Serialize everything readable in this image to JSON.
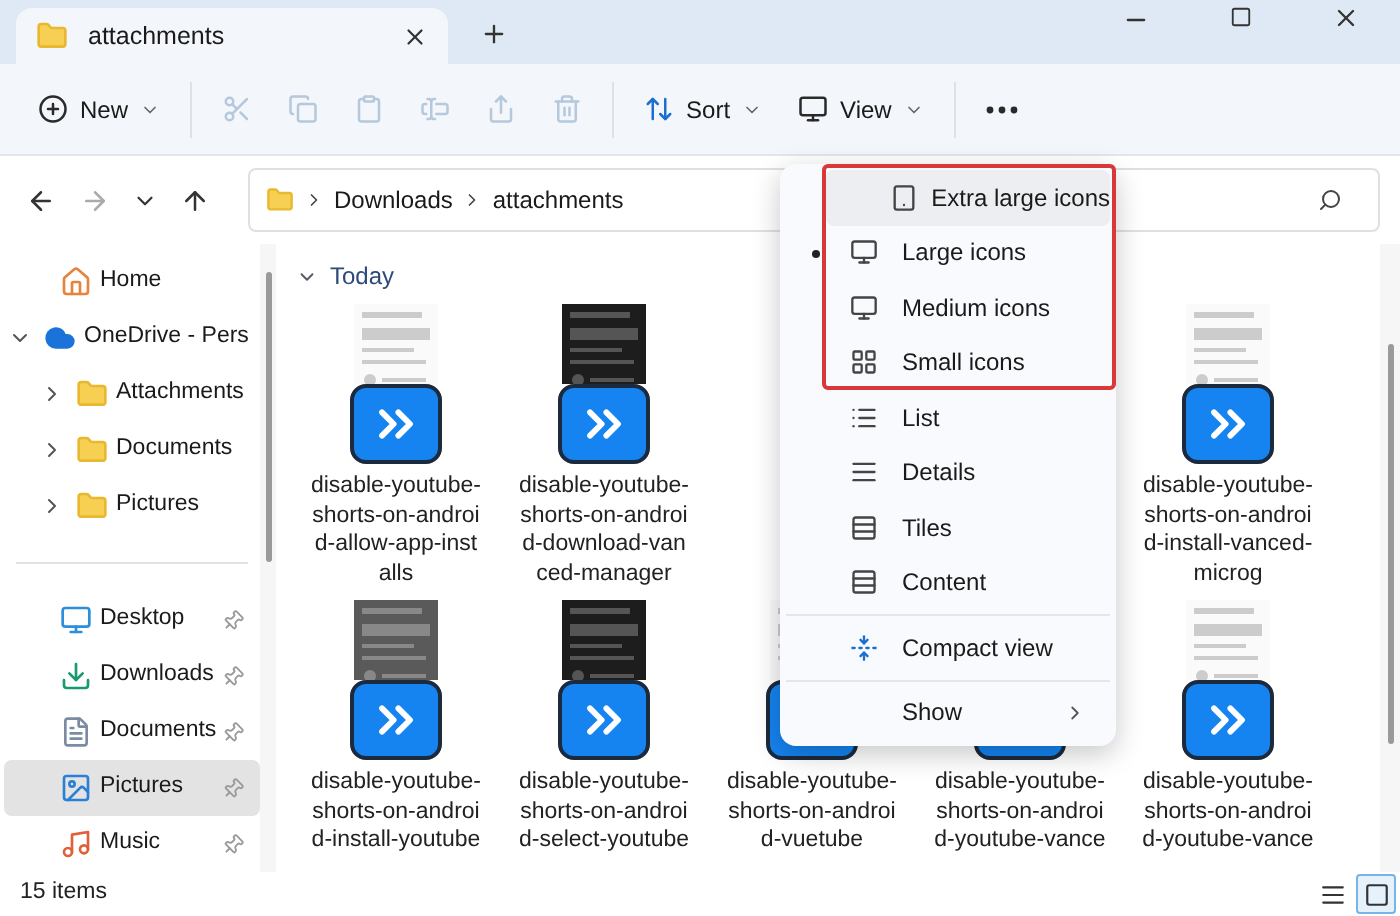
{
  "window": {
    "tab": {
      "title": "attachments",
      "selected": true
    }
  },
  "toolbar": {
    "items": [
      {
        "kind": "new",
        "label": "New",
        "disabled": false
      },
      {
        "kind": "cut",
        "disabled": true
      },
      {
        "kind": "copy",
        "disabled": true
      },
      {
        "kind": "paste",
        "disabled": true
      },
      {
        "kind": "rename",
        "disabled": true
      },
      {
        "kind": "share",
        "disabled": true
      },
      {
        "kind": "delete",
        "disabled": true
      },
      {
        "kind": "sort",
        "label": "Sort",
        "disabled": false
      },
      {
        "kind": "view",
        "label": "View",
        "disabled": false
      },
      {
        "kind": "more",
        "disabled": false
      }
    ]
  },
  "address_bar": {
    "path": [
      "Downloads",
      "attachments"
    ]
  },
  "sidebar": {
    "items": [
      {
        "kind": "home",
        "label": "Home",
        "selected": false
      },
      {
        "kind": "cloud",
        "label": "OneDrive - Pers",
        "selected": false,
        "expanded": true,
        "children": [
          {
            "kind": "folder",
            "label": "Attachments",
            "expanded": false,
            "selected": false
          },
          {
            "kind": "folder",
            "label": "Documents",
            "expanded": false,
            "selected": false
          },
          {
            "kind": "folder",
            "label": "Pictures",
            "expanded": false,
            "selected": false
          }
        ]
      }
    ],
    "quick_access": [
      {
        "kind": "desktop",
        "label": "Desktop",
        "pinned": true,
        "selected": false
      },
      {
        "kind": "downloads",
        "label": "Downloads",
        "pinned": true,
        "selected": false
      },
      {
        "kind": "documents",
        "label": "Documents",
        "pinned": true,
        "selected": false
      },
      {
        "kind": "pictures",
        "label": "Pictures",
        "pinned": true,
        "selected": true
      },
      {
        "kind": "music",
        "label": "Music",
        "pinned": true,
        "selected": false
      }
    ]
  },
  "group": {
    "title": "Today",
    "expanded": true
  },
  "files": [
    {
      "name": "disable-youtube-shorts-on-android-allow-app-installs"
    },
    {
      "name": "disable-youtube-shorts-on-android-download-vanced-manager"
    },
    {
      "name": "disable-youtube-shorts-on-android-install-vanced-microg"
    },
    {
      "name": "disable-youtube-shorts-on-android-install-youtube"
    },
    {
      "name": "disable-youtube-shorts-on-android-select-youtube"
    },
    {
      "name": "disable-youtube-shorts-on-android-vuetube"
    },
    {
      "name": "disable-youtube-shorts-on-android-youtube-vance"
    },
    {
      "name": "disable-youtube-shorts-on-android-youtube-vance"
    }
  ],
  "view_menu": {
    "sections": [
      {
        "outlined": true,
        "items": [
          {
            "kind": "xl",
            "label": "Extra large icons",
            "selected": false,
            "hovered": true
          },
          {
            "kind": "large",
            "label": "Large icons",
            "selected": true,
            "hovered": false
          },
          {
            "kind": "medium",
            "label": "Medium icons",
            "selected": false,
            "hovered": false
          },
          {
            "kind": "small",
            "label": "Small icons",
            "selected": false,
            "hovered": false
          }
        ]
      },
      {
        "outlined": false,
        "items": [
          {
            "kind": "list",
            "label": "List",
            "selected": false,
            "hovered": false
          },
          {
            "kind": "details",
            "label": "Details",
            "selected": false,
            "hovered": false
          },
          {
            "kind": "tiles",
            "label": "Tiles",
            "selected": false,
            "hovered": false
          },
          {
            "kind": "content",
            "label": "Content",
            "selected": false,
            "hovered": false
          }
        ]
      },
      {
        "outlined": false,
        "items": [
          {
            "kind": "compact",
            "label": "Compact view",
            "selected": false,
            "hovered": false
          }
        ]
      },
      {
        "outlined": false,
        "items": [
          {
            "kind": "submenu",
            "label": "Show",
            "selected": false,
            "hovered": false
          }
        ]
      }
    ]
  },
  "status_bar": {
    "count": "15 items",
    "view_buttons": [
      {
        "kind": "details",
        "selected": false
      },
      {
        "kind": "large",
        "selected": true
      }
    ]
  }
}
